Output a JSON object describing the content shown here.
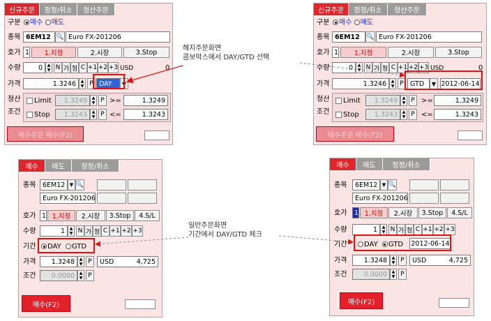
{
  "panel1": {
    "tabs": [
      "신규주문",
      "정정/취소",
      "청산주문"
    ],
    "gubun_label": "구분",
    "radio_buy": "매수",
    "radio_sell": "매도",
    "jongmok_label": "종목",
    "code": "6EM12",
    "name": "Euro FX-201206",
    "hoga_label": "호가",
    "hoga_num": "1",
    "hoga_opts": [
      "1.지정",
      "2.시장",
      "3.Stop"
    ],
    "qty_label": "수량",
    "qty": "0",
    "qty_btns": [
      "N",
      "가",
      "청",
      "C",
      "+1",
      "+2",
      "+3"
    ],
    "currency": "USD",
    "currency_val": "0",
    "price_label": "가격",
    "price": "1.3246",
    "p": "P",
    "term": "DAY",
    "clear_label1": "청산",
    "clear_label2": "조건",
    "limit_label": "Limit",
    "stop_label": "Stop",
    "limit_price": "1.3249",
    "stop_price": "1.3243",
    "ge": ">=",
    "le": "<=",
    "limit_right": "1.3249",
    "stop_right": "1.3243",
    "submit": "매수주문 매수(F2)"
  },
  "panel2": {
    "tabs": [
      "신규주문",
      "정정/취소",
      "청산주문"
    ],
    "gubun_label": "구분",
    "radio_buy": "매수",
    "radio_sell": "매도",
    "jongmok_label": "종목",
    "code": "6EM12",
    "name": "Euro FX-201206",
    "hoga_label": "호가",
    "hoga_num": "1",
    "hoga_opts": [
      "1.지정",
      "2.시장",
      "3.Stop"
    ],
    "qty_label": "수량",
    "qty": "0",
    "qty_btns": [
      "N",
      "가",
      "청",
      "C",
      "+1",
      "+2",
      "+3"
    ],
    "currency": "USD",
    "currency_val": "0",
    "price_label": "가격",
    "price": "1.3246",
    "p": "P",
    "term": "GTD",
    "date": "2012-06-14",
    "clear_label1": "청산",
    "clear_label2": "조건",
    "limit_label": "Limit",
    "stop_label": "Stop",
    "limit_price": "1.3249",
    "stop_price": "1.3243",
    "ge": ">=",
    "le": "<=",
    "limit_right": "1.3249",
    "stop_right": "1.3243",
    "submit": "매수주문 매수(F2)"
  },
  "panel3": {
    "tabs": [
      "매수",
      "매도",
      "정정/취소"
    ],
    "jongmok_label": "종목",
    "code": "6EM12",
    "name": "Euro FX-201206",
    "hoga_label": "호가",
    "hoga_num": "1",
    "hoga_opts": [
      "1.지정",
      "2.시장",
      "3.Stop",
      "4.S/L"
    ],
    "qty_label": "수량",
    "qty": "1",
    "qty_btns": [
      "N",
      "가",
      "청",
      "C",
      "+1",
      "+2",
      "+3"
    ],
    "term_label": "기간",
    "term_day": "DAY",
    "term_gtd": "GTD",
    "price_label": "가격",
    "price": "1.3248",
    "p": "P",
    "currency": "USD",
    "amount": "4,725",
    "cond_label": "조건",
    "cond_price": "0.0000",
    "submit": "매수(F2)"
  },
  "panel4": {
    "tabs": [
      "매수",
      "매도",
      "정정/취소"
    ],
    "jongmok_label": "종목",
    "code": "6EM12",
    "name": "Euro FX-201206",
    "hoga_label": "호가",
    "hoga_num": "1",
    "hoga_opts": [
      "1.지정",
      "2.시장",
      "3.Stop",
      "4.S/L"
    ],
    "qty_label": "수량",
    "qty": "1",
    "qty_btns": [
      "N",
      "가",
      "청",
      "C",
      "+1",
      "+2",
      "+3"
    ],
    "term_label": "기간",
    "term_day": "DAY",
    "term_gtd": "GTD",
    "date": "2012-06-14",
    "price_label": "가격",
    "price": "1.3248",
    "p": "P",
    "currency": "USD",
    "amount": "4,725",
    "cond_label": "조건",
    "cond_price": "0.0000",
    "submit": "매수(F2)"
  },
  "annotations": {
    "top_line1": "헤지주문화면",
    "top_line2": "콤보박스에서 DAY/GTD 선택",
    "bottom_line1": "일반주문화면",
    "bottom_line2": "기간에서 DAY/GTD 체크"
  },
  "colors": {
    "accent_red": "#e0262d",
    "panel_bg": "#fbe4e4",
    "highlight": "#e31010"
  }
}
